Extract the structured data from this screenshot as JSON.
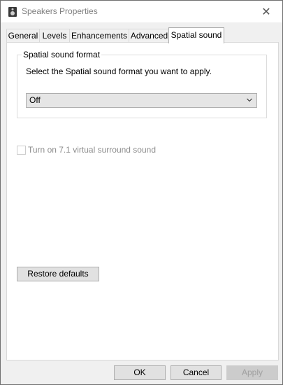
{
  "window": {
    "title": "Speakers Properties",
    "close_glyph": "✕"
  },
  "tabs": [
    {
      "label": "General"
    },
    {
      "label": "Levels"
    },
    {
      "label": "Enhancements"
    },
    {
      "label": "Advanced"
    },
    {
      "label": "Spatial sound",
      "active": true
    }
  ],
  "spatial_group": {
    "legend": "Spatial sound format",
    "description": "Select the Spatial sound format you want to apply.",
    "selected": "Off"
  },
  "surround": {
    "label": "Turn on 7.1 virtual surround sound",
    "checked": false,
    "enabled": false
  },
  "restore_button": "Restore defaults",
  "footer": {
    "ok": "OK",
    "cancel": "Cancel",
    "apply": "Apply",
    "apply_enabled": false
  },
  "icons": {
    "title": "speaker-icon",
    "close": "close-icon",
    "dropdown": "chevron-down-icon"
  }
}
